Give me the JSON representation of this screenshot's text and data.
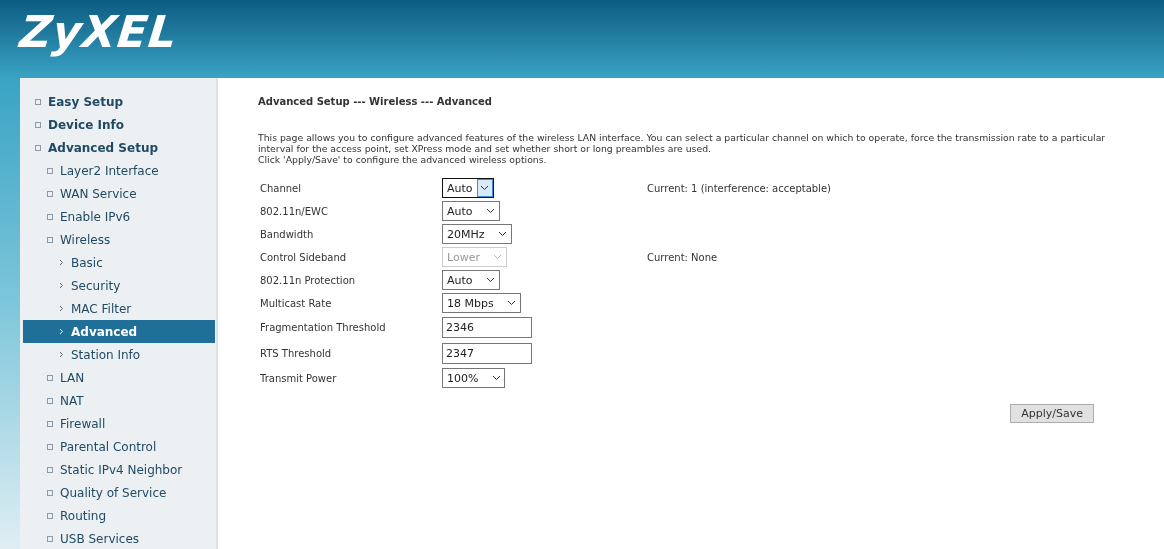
{
  "logo": "ZyXEL",
  "sidebar": {
    "items": [
      {
        "label": "Easy Setup",
        "selected": false
      },
      {
        "label": "Device Info",
        "selected": false
      },
      {
        "label": "Advanced Setup",
        "selected": false,
        "children": [
          {
            "label": "Layer2 Interface",
            "selected": false
          },
          {
            "label": "WAN Service",
            "selected": false
          },
          {
            "label": "Enable IPv6",
            "selected": false
          },
          {
            "label": "Wireless",
            "selected": false,
            "children": [
              {
                "label": "Basic",
                "selected": false
              },
              {
                "label": "Security",
                "selected": false
              },
              {
                "label": "MAC Filter",
                "selected": false
              },
              {
                "label": "Advanced",
                "selected": true
              },
              {
                "label": "Station Info",
                "selected": false
              }
            ]
          },
          {
            "label": "LAN",
            "selected": false
          },
          {
            "label": "NAT",
            "selected": false
          },
          {
            "label": "Firewall",
            "selected": false
          },
          {
            "label": "Parental Control",
            "selected": false
          },
          {
            "label": "Static IPv4 Neighbor",
            "selected": false
          },
          {
            "label": "Quality of Service",
            "selected": false
          },
          {
            "label": "Routing",
            "selected": false
          },
          {
            "label": "USB Services",
            "selected": false
          }
        ]
      }
    ]
  },
  "page": {
    "title": "Advanced Setup --- Wireless --- Advanced",
    "description": [
      "This page allows you to configure advanced features of the wireless LAN interface. You can select a particular channel on which to operate, force the transmission rate to a particular",
      "interval for the access point, set XPress mode and set whether short or long preambles are used.",
      "Click 'Apply/Save' to configure the advanced wireless options."
    ],
    "fields": [
      {
        "label": "Channel",
        "kind": "select",
        "value": "Auto",
        "disabled": false,
        "focused": true,
        "note": "Current: 1 (interference: acceptable)"
      },
      {
        "label": "802.11n/EWC",
        "kind": "select",
        "value": "Auto",
        "disabled": false,
        "focused": false
      },
      {
        "label": "Bandwidth",
        "kind": "select",
        "value": "20MHz",
        "disabled": false,
        "focused": false
      },
      {
        "label": "Control Sideband",
        "kind": "select",
        "value": "Lower",
        "disabled": true,
        "focused": false,
        "note": "Current: None"
      },
      {
        "label": "802.11n Protection",
        "kind": "select",
        "value": "Auto",
        "disabled": false,
        "focused": false
      },
      {
        "label": "Multicast Rate",
        "kind": "select",
        "value": "18 Mbps",
        "disabled": false,
        "focused": false
      },
      {
        "label": "Fragmentation Threshold",
        "kind": "text",
        "value": "2346",
        "disabled": false,
        "focused": false
      },
      {
        "label": "RTS Threshold",
        "kind": "text",
        "value": "2347",
        "disabled": false,
        "focused": false
      },
      {
        "label": "Transmit Power",
        "kind": "select",
        "value": "100%",
        "disabled": false,
        "focused": false
      }
    ],
    "button": "Apply/Save"
  }
}
